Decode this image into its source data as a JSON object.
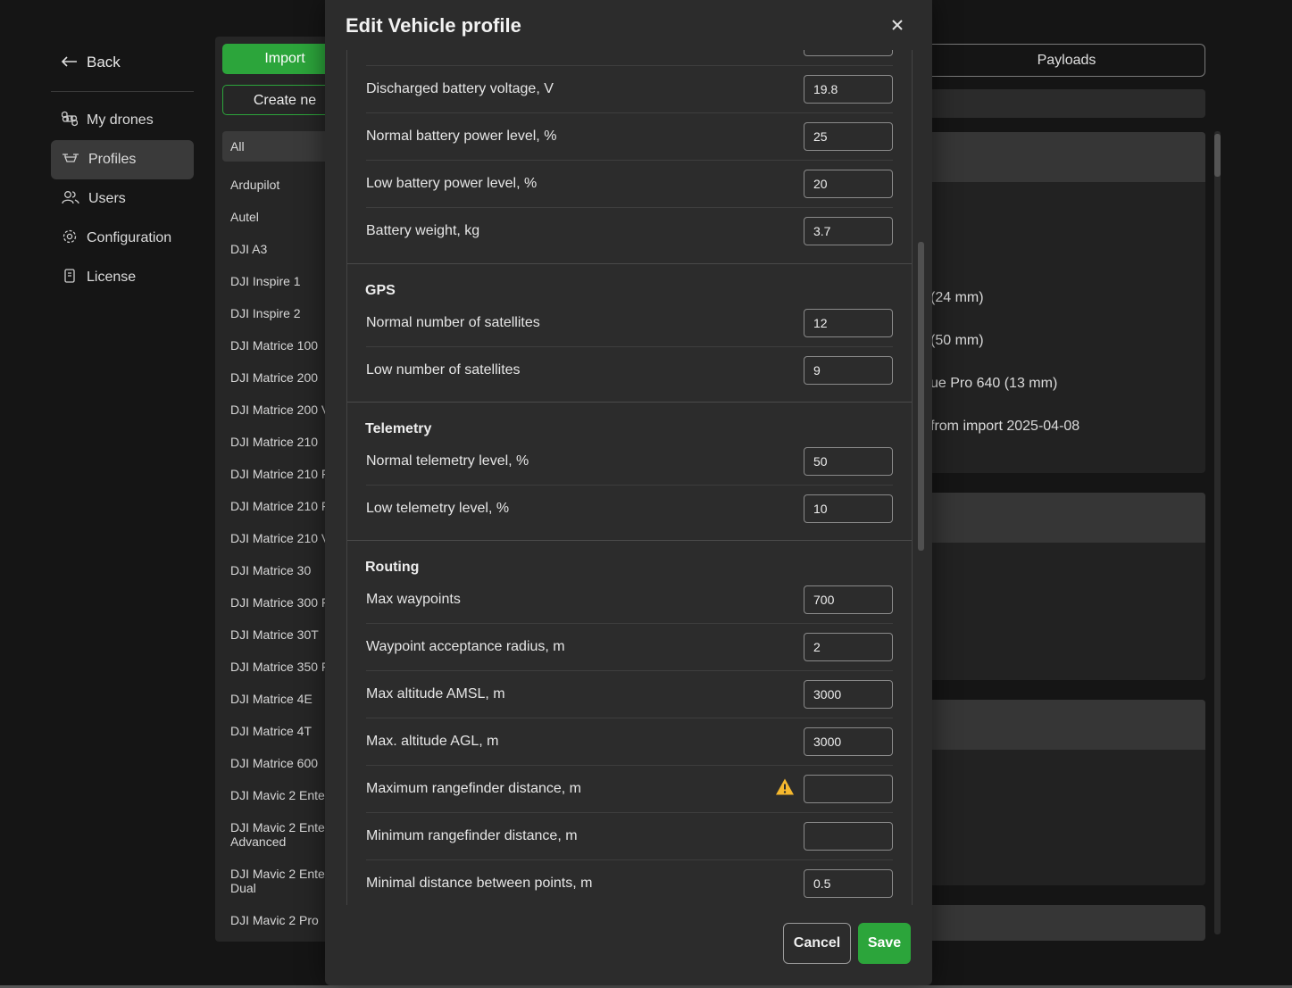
{
  "sidebar": {
    "back_label": "Back",
    "items": [
      {
        "label": "My drones",
        "icon": "command-icon"
      },
      {
        "label": "Profiles",
        "icon": "drone-icon"
      },
      {
        "label": "Users",
        "icon": "users-icon"
      },
      {
        "label": "Configuration",
        "icon": "gear-icon"
      },
      {
        "label": "License",
        "icon": "license-icon"
      }
    ]
  },
  "list_panel": {
    "import_label": "Import",
    "create_label": "Create ne",
    "filter_value": "All",
    "profiles": [
      "Ardupilot",
      "Autel",
      "DJI A3",
      "DJI Inspire 1",
      "DJI Inspire 2",
      "DJI Matrice 100",
      "DJI Matrice 200",
      "DJI Matrice 200 V",
      "DJI Matrice 210",
      "DJI Matrice 210 F",
      "DJI Matrice 210 F",
      "DJI Matrice 210 V",
      "DJI Matrice 30",
      "DJI Matrice 300 F",
      "DJI Matrice 30T",
      "DJI Matrice 350 F",
      "DJI Matrice 4E",
      "DJI Matrice 4T",
      "DJI Matrice 600",
      "DJI Mavic 2 Enter",
      "DJI Mavic 2 Enter\nAdvanced",
      "DJI Mavic 2 Enter\nDual",
      "DJI Mavic 2 Pro"
    ]
  },
  "right_area": {
    "tab_payloads": "Payloads",
    "card_texts": [
      "(24 mm)",
      "(50 mm)",
      "ue Pro 640 (13 mm)",
      "from import 2025-04-08"
    ]
  },
  "modal": {
    "title": "Edit Vehicle profile",
    "close_icon": "close-icon",
    "rows_battery": [
      {
        "label": "Discharged battery voltage, V",
        "value": "19.8"
      },
      {
        "label": "Normal battery power level, %",
        "value": "25"
      },
      {
        "label": "Low battery power level, %",
        "value": "20"
      },
      {
        "label": "Battery weight, kg",
        "value": "3.7"
      }
    ],
    "gps": {
      "title": "GPS",
      "rows": [
        {
          "label": "Normal number of satellites",
          "value": "12"
        },
        {
          "label": "Low number of satellites",
          "value": "9"
        }
      ]
    },
    "telemetry": {
      "title": "Telemetry",
      "rows": [
        {
          "label": "Normal telemetry level, %",
          "value": "50"
        },
        {
          "label": "Low telemetry level, %",
          "value": "10"
        }
      ]
    },
    "routing": {
      "title": "Routing",
      "rows": [
        {
          "label": "Max waypoints",
          "value": "700"
        },
        {
          "label": "Waypoint acceptance radius, m",
          "value": "2"
        },
        {
          "label": "Max altitude AMSL, m",
          "value": "3000"
        },
        {
          "label": "Max. altitude AGL, m",
          "value": "3000"
        },
        {
          "label": "Maximum rangefinder distance, m",
          "value": ""
        },
        {
          "label": "Minimum rangefinder distance, m",
          "value": ""
        },
        {
          "label": "Minimal distance between points, m",
          "value": "0.5"
        }
      ]
    },
    "cancel_label": "Cancel",
    "save_label": "Save"
  },
  "colors": {
    "accent": "#2ca53b",
    "warning": "#f5b82e"
  }
}
